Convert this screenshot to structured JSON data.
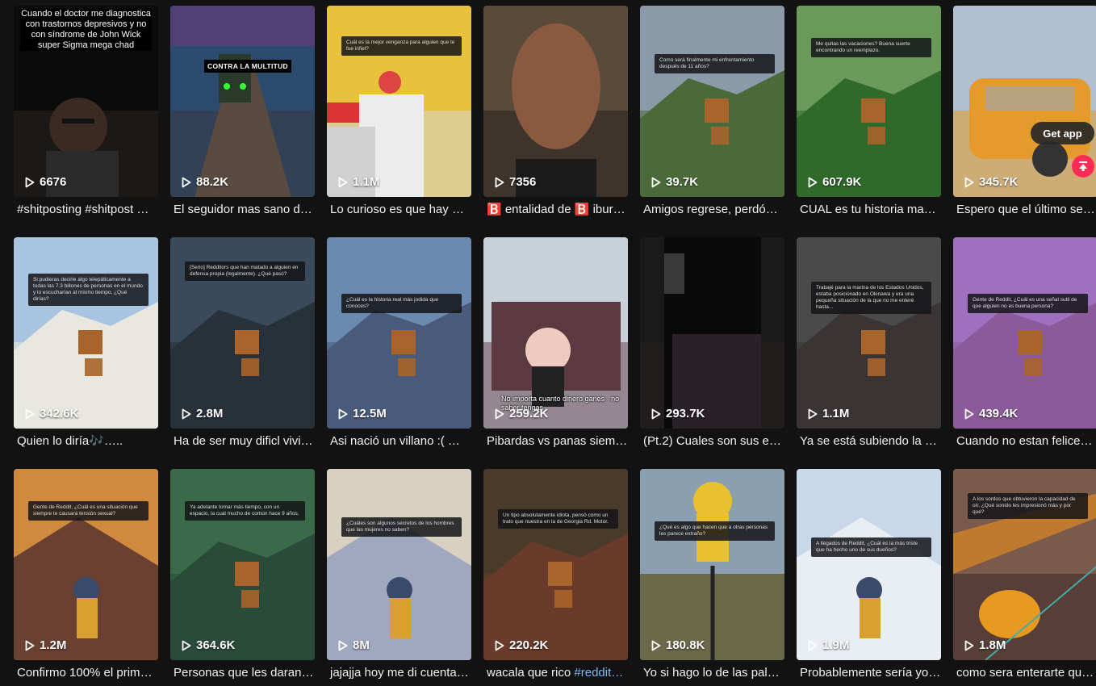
{
  "videos": [
    {
      "views": "6676",
      "caption": "#shitposting #shitpost …",
      "tag": true,
      "top_text": "Cuando el doctor me diagnostica con trastornos depresivos y no con síndrome de John Wick super Sigma mega chad"
    },
    {
      "views": "88.2K",
      "caption": "El seguidor mas sano d…",
      "banner": "CONTRA LA MULTITUD"
    },
    {
      "views": "1.1M",
      "caption": "Lo curioso es que hay m…",
      "overlay": "Cuál es la mejor venganza para alguien que te fue infiel?"
    },
    {
      "views": "7356",
      "caption": "🅱️ entalidad de 🅱️ iburo…"
    },
    {
      "views": "39.7K",
      "caption": "Amigos regrese, perdón…",
      "overlay": "Como será finalmente mi enfrentamiento después de 11 años?"
    },
    {
      "views": "607.9K",
      "caption": "CUAL es tu historia man…",
      "overlay": "Me quitas las vacaciones? Buena suerte encontrando un reemplazo."
    },
    {
      "views": "345.7K",
      "caption": "Espero que el último se…"
    },
    {
      "views": "342.6K",
      "caption": "Quien lo diría🎶…..",
      "overlay": "Si pudieras decirle algo telepáticamente a todas las 7.3 billones de personas en el mundo y lo escucharían al mismo tiempo, ¿Qué dirías?"
    },
    {
      "views": "2.8M",
      "caption": "Ha de ser muy dificl vivi…",
      "overlay": "[Serio] Redditors que han matado a alguien en defensa propia (legalmente). ¿Qué pasó?"
    },
    {
      "views": "12.5M",
      "caption": "Asi nació un villano :( …",
      "overlay": "¿Cuál es la historia real más jodida que conoces?"
    },
    {
      "views": "259.2K",
      "caption": "Pibardas vs panas siem…",
      "subtitle": "No importa cuanto dinero ganes · no saber tengas"
    },
    {
      "views": "293.7K",
      "caption": "(Pt.2) Cuales son sus ex…"
    },
    {
      "views": "1.1M",
      "caption": "Ya se está subiendo la p…",
      "overlay": "Trabajé para la marina de los Estados Unidos, estaba posicionado en Okinawa y era una pequeña situación de la que no me enteré hasta..."
    },
    {
      "views": "439.4K",
      "caption": "Cuando no estan felices…",
      "overlay": "Gente de Reddit, ¿Cuál es una señal sutil de que alguien no es buena persona?"
    },
    {
      "views": "1.2M",
      "caption": "Confirmo 100% el prime…",
      "overlay": "Gente de Reddit, ¿Cuál es una situación que siempre te causará tensión sexual?"
    },
    {
      "views": "364.6K",
      "caption": "Personas que les daran …",
      "overlay": "Ya adelante tomar más tiempo, con un espacio, la cual mucho de común hace 9 años."
    },
    {
      "views": "8M",
      "caption": "jajajja hoy me di cuenta …",
      "overlay": "¿Cuáles son algunos secretos de los hombres que las mujeres no saben?"
    },
    {
      "views": "220.2K",
      "caption": "wacala que rico #reddit…",
      "tag_word": "#reddit…",
      "caption_plain": "wacala que rico ",
      "overlay": "Un tipo absolutamente idiota, pensó como un trato que nuestra en la de Georgia Rd. Motor."
    },
    {
      "views": "180.8K",
      "caption": "Yo si hago lo de las palo…",
      "overlay": "¿Qué es algo que hacen que a otras personas les parece extraño?"
    },
    {
      "views": "1.9M",
      "caption": "Probablemente sería yo …",
      "overlay": "A llegados de Reddit, ¿Cuál es la más triste que ha hecho uno de sus dueños?"
    },
    {
      "views": "1.8M",
      "caption": "como sera enterarte qu…",
      "overlay": "A los sordos que obtuvieron la capacidad de oír, ¿Qué sonido les impresionó más y por qué?"
    }
  ],
  "controls": {
    "get_app": "Get app"
  },
  "colors": {
    "background": "#121212",
    "accent": "#fe2c55",
    "hashtag": "#7eb8ff"
  }
}
